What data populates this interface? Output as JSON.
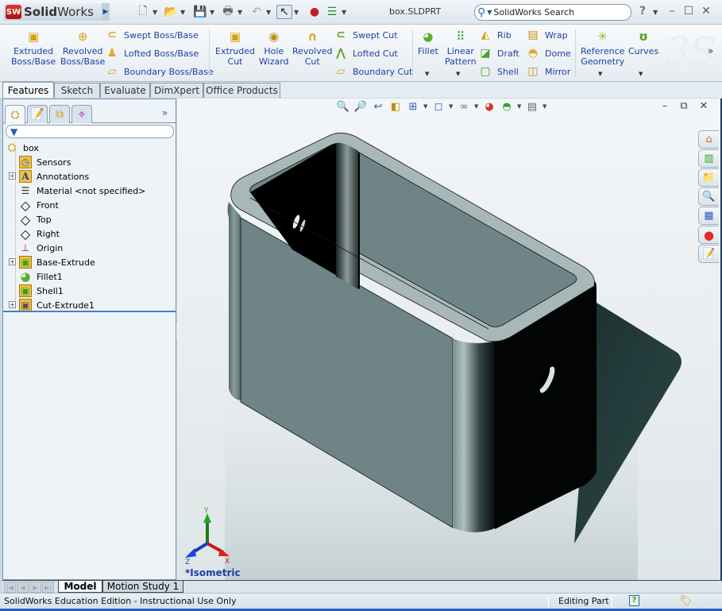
{
  "app": {
    "brand": "SolidWorks",
    "brand_logo": "SW",
    "document_title": "box.SLDPRT",
    "search_placeholder": "SolidWorks Search"
  },
  "quick_access": [
    {
      "icon": "new-document-icon",
      "glyph": "🗋",
      "has_dropdown": true
    },
    {
      "icon": "open-folder-icon",
      "glyph": "📂",
      "has_dropdown": true
    },
    {
      "icon": "save-icon",
      "glyph": "💾",
      "has_dropdown": true
    },
    {
      "icon": "print-icon",
      "glyph": "🖶",
      "has_dropdown": true
    },
    {
      "icon": "undo-icon",
      "glyph": "↶",
      "has_dropdown": true
    },
    {
      "icon": "select-pointer-icon",
      "glyph": "↖",
      "has_dropdown": true
    },
    {
      "icon": "rebuild-traffic-light-icon",
      "glyph": "●",
      "has_dropdown": false
    },
    {
      "icon": "options-icon",
      "glyph": "☰",
      "has_dropdown": true
    }
  ],
  "window_controls": {
    "help": "?",
    "minimize": "–",
    "maximize": "☐",
    "close": "✕"
  },
  "ribbon": {
    "large_buttons": [
      {
        "id": "extruded-boss-base",
        "label1": "Extruded",
        "label2": "Boss/Base",
        "glyph": "▣"
      },
      {
        "id": "revolved-boss-base",
        "label1": "Revolved",
        "label2": "Boss/Base",
        "glyph": "⊕"
      },
      {
        "id": "extruded-cut",
        "label1": "Extruded",
        "label2": "Cut",
        "glyph": "▣"
      },
      {
        "id": "hole-wizard",
        "label1": "Hole",
        "label2": "Wizard",
        "glyph": "◉"
      },
      {
        "id": "revolved-cut",
        "label1": "Revolved",
        "label2": "Cut",
        "glyph": "∩"
      },
      {
        "id": "fillet",
        "label1": "Fillet",
        "label2": "",
        "glyph": "◕"
      },
      {
        "id": "linear-pattern",
        "label1": "Linear",
        "label2": "Pattern",
        "glyph": "⠿"
      },
      {
        "id": "reference-geometry",
        "label1": "Reference",
        "label2": "Geometry",
        "glyph": "✳"
      },
      {
        "id": "curves",
        "label1": "Curves",
        "label2": "",
        "glyph": "ʊ"
      }
    ],
    "small_buttons": [
      {
        "id": "swept-boss-base",
        "label": "Swept Boss/Base",
        "glyph": "⊂"
      },
      {
        "id": "lofted-boss-base",
        "label": "Lofted Boss/Base",
        "glyph": "♟"
      },
      {
        "id": "boundary-boss-base",
        "label": "Boundary Boss/Base",
        "glyph": "▱"
      },
      {
        "id": "swept-cut",
        "label": "Swept Cut",
        "glyph": "⊂"
      },
      {
        "id": "lofted-cut",
        "label": "Lofted Cut",
        "glyph": "⋀"
      },
      {
        "id": "boundary-cut",
        "label": "Boundary Cut",
        "glyph": "▱"
      },
      {
        "id": "rib",
        "label": "Rib",
        "glyph": "◭"
      },
      {
        "id": "draft",
        "label": "Draft",
        "glyph": "◪"
      },
      {
        "id": "shell",
        "label": "Shell",
        "glyph": "▢"
      },
      {
        "id": "wrap",
        "label": "Wrap",
        "glyph": "▤"
      },
      {
        "id": "dome",
        "label": "Dome",
        "glyph": "◓"
      },
      {
        "id": "mirror",
        "label": "Mirror",
        "glyph": "◫"
      }
    ],
    "overflow": "»"
  },
  "command_tabs": [
    {
      "label": "Features",
      "active": true
    },
    {
      "label": "Sketch",
      "active": false
    },
    {
      "label": "Evaluate",
      "active": false
    },
    {
      "label": "DimXpert",
      "active": false
    },
    {
      "label": "Office Products",
      "active": false
    }
  ],
  "manager_tabs": [
    {
      "name": "featuremanager-tab",
      "glyph": "⛭",
      "active": true
    },
    {
      "name": "propertymanager-tab",
      "glyph": "📝",
      "active": false
    },
    {
      "name": "configurationmanager-tab",
      "glyph": "⧉",
      "active": false
    },
    {
      "name": "dimxpertmanager-tab",
      "glyph": "⌖",
      "active": false
    }
  ],
  "manager_overflow": "»",
  "filter_glyph": "▼",
  "feature_tree": [
    {
      "label": "box",
      "glyph": "⛭",
      "indent": 0,
      "expandable": false,
      "icon": "part-icon",
      "color": "#c99a18"
    },
    {
      "label": "Sensors",
      "glyph": "◷",
      "indent": 1,
      "expandable": false,
      "icon": "sensors-folder-icon",
      "color": "#e0a820"
    },
    {
      "label": "Annotations",
      "glyph": "A",
      "indent": 1,
      "expandable": true,
      "icon": "annotations-folder-icon",
      "color": "#1c3ea8"
    },
    {
      "label": "Material <not specified>",
      "glyph": "☰",
      "indent": 1,
      "expandable": false,
      "icon": "material-icon",
      "color": "#333"
    },
    {
      "label": "Front",
      "glyph": "◇",
      "indent": 1,
      "expandable": false,
      "icon": "plane-icon",
      "color": "#333"
    },
    {
      "label": "Top",
      "glyph": "◇",
      "indent": 1,
      "expandable": false,
      "icon": "plane-icon",
      "color": "#333"
    },
    {
      "label": "Right",
      "glyph": "◇",
      "indent": 1,
      "expandable": false,
      "icon": "plane-icon",
      "color": "#333"
    },
    {
      "label": "Origin",
      "glyph": "⊥",
      "indent": 1,
      "expandable": false,
      "icon": "origin-icon",
      "color": "#a01818"
    },
    {
      "label": "Base-Extrude",
      "glyph": "▣",
      "indent": 1,
      "expandable": true,
      "icon": "extrude-feature-icon",
      "color": "#d4a010"
    },
    {
      "label": "Fillet1",
      "glyph": "◕",
      "indent": 1,
      "expandable": false,
      "icon": "fillet-feature-icon",
      "color": "#58b028"
    },
    {
      "label": "Shell1",
      "glyph": "▣",
      "indent": 1,
      "expandable": false,
      "icon": "shell-feature-icon",
      "color": "#38a028"
    },
    {
      "label": "Cut-Extrude1",
      "glyph": "▣",
      "indent": 1,
      "expandable": true,
      "icon": "cut-extrude-feature-icon",
      "color": "#c99a18"
    }
  ],
  "viewport": {
    "heads_up_toolbar": [
      {
        "icon": "zoom-to-fit-icon",
        "glyph": "🔍",
        "dropdown": false
      },
      {
        "icon": "zoom-to-area-icon",
        "glyph": "🔎",
        "dropdown": false
      },
      {
        "icon": "previous-view-icon",
        "glyph": "↩",
        "dropdown": false
      },
      {
        "icon": "section-view-icon",
        "glyph": "◧",
        "dropdown": false
      },
      {
        "icon": "view-orientation-icon",
        "glyph": "⊞",
        "dropdown": true
      },
      {
        "icon": "display-style-icon",
        "glyph": "◻",
        "dropdown": true
      },
      {
        "icon": "hide-show-items-icon",
        "glyph": "∞",
        "dropdown": true
      },
      {
        "icon": "edit-appearance-icon",
        "glyph": "◕",
        "dropdown": false
      },
      {
        "icon": "apply-scene-icon",
        "glyph": "◓",
        "dropdown": true
      },
      {
        "icon": "view-settings-icon",
        "glyph": "▤",
        "dropdown": true
      }
    ],
    "view_label": "*Isometric",
    "triad": {
      "x": "X",
      "y": "Y",
      "z": "Z"
    },
    "controls": {
      "minimize": "–",
      "restore": "🗗",
      "close": "✕"
    }
  },
  "task_pane": [
    {
      "icon": "solidworks-resources-icon",
      "glyph": "⌂"
    },
    {
      "icon": "design-library-icon",
      "glyph": "▥"
    },
    {
      "icon": "file-explorer-icon",
      "glyph": "📁"
    },
    {
      "icon": "search-icon",
      "glyph": "🔍"
    },
    {
      "icon": "view-palette-icon",
      "glyph": "▦"
    },
    {
      "icon": "appearances-icon",
      "glyph": "●"
    },
    {
      "icon": "custom-properties-icon",
      "glyph": "📝"
    }
  ],
  "bottom_tabs": [
    {
      "label": "Model",
      "active": true
    },
    {
      "label": "Motion Study 1",
      "active": false
    }
  ],
  "status_bar": {
    "left_text": "SolidWorks Education Edition - Instructional Use Only",
    "mode": "Editing Part",
    "help_glyph": "?",
    "tag_glyph": "🏷"
  },
  "colors": {
    "accent_blue": "#1c3ea8",
    "tree_selection_bar": "#3d7fd0",
    "model_face": "#6e8486",
    "model_edge": "#a8b8b8"
  }
}
